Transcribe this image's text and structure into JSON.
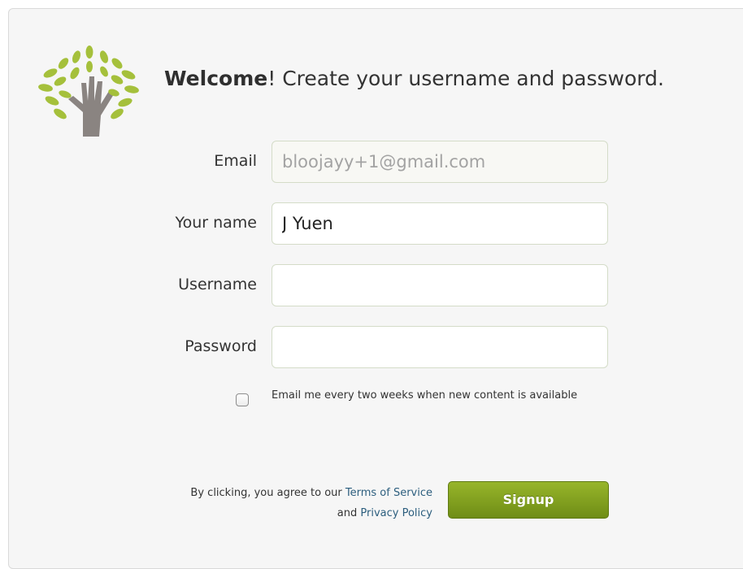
{
  "header": {
    "welcome_bold": "Welcome",
    "welcome_rest": "! Create your username and password."
  },
  "form": {
    "email": {
      "label": "Email",
      "value": "bloojayy+1@gmail.com"
    },
    "name": {
      "label": "Your name",
      "value": "J Yuen"
    },
    "username": {
      "label": "Username",
      "value": ""
    },
    "password": {
      "label": "Password",
      "value": ""
    },
    "newsletter": {
      "label": "Email me every two weeks when new content is available",
      "checked": false
    }
  },
  "footer": {
    "terms_prefix": "By clicking, you agree to our",
    "terms_link": "Terms of Service",
    "terms_and": "and",
    "privacy_link": "Privacy Policy",
    "signup_label": "Signup"
  },
  "colors": {
    "leaf_green": "#a5c03b",
    "trunk_gray": "#8a8481",
    "button_green": "#7d9b1c",
    "link_blue": "#2c5e7e"
  },
  "icons": {
    "logo": "tree-hand-icon"
  }
}
